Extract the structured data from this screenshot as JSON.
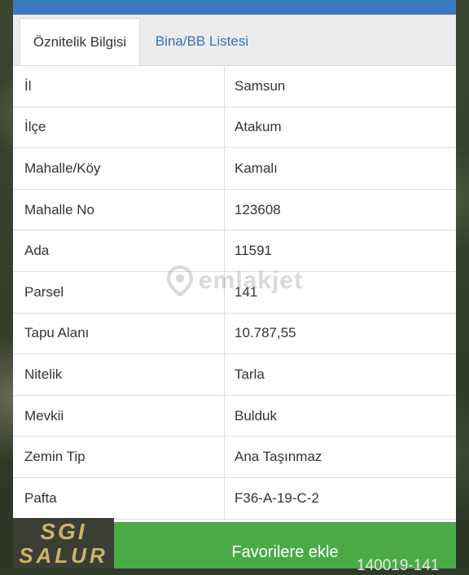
{
  "tabs": [
    {
      "label": "Öznitelik Bilgisi"
    },
    {
      "label": "Bina/BB Listesi"
    }
  ],
  "rows": [
    {
      "key": "İl",
      "value": "Samsun"
    },
    {
      "key": "İlçe",
      "value": "Atakum"
    },
    {
      "key": "Mahalle/Köy",
      "value": "Kamalı"
    },
    {
      "key": "Mahalle No",
      "value": "123608"
    },
    {
      "key": "Ada",
      "value": "11591"
    },
    {
      "key": "Parsel",
      "value": "141"
    },
    {
      "key": "Tapu Alanı",
      "value": "10.787,55"
    },
    {
      "key": "Nitelik",
      "value": "Tarla"
    },
    {
      "key": "Mevkii",
      "value": "Bulduk"
    },
    {
      "key": "Zemin Tip",
      "value": "Ana Taşınmaz"
    },
    {
      "key": "Pafta",
      "value": "F36-A-19-C-2"
    }
  ],
  "favorite_button": "Favorilere ekle",
  "watermark": "emlakjet",
  "logo": {
    "line1": "SGI",
    "line2": "SALUR"
  },
  "bottom_code": "140019-141",
  "colors": {
    "accent": "#3b79bf",
    "button": "#4aab46",
    "tab_link": "#2f72b9"
  }
}
